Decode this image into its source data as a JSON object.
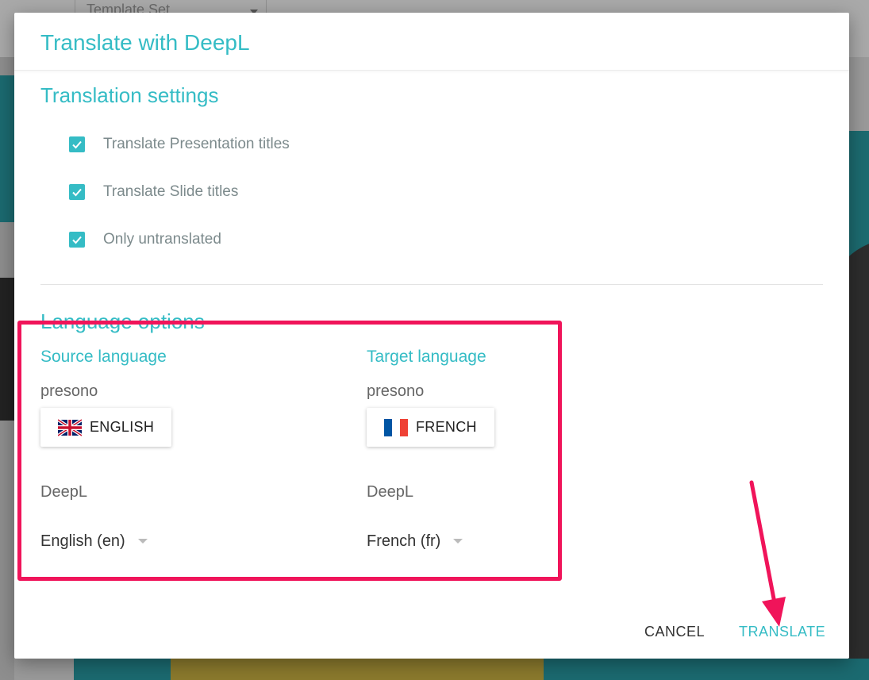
{
  "background": {
    "template_set_label": "Template Set"
  },
  "dialog": {
    "title": "Translate with DeepL",
    "settings": {
      "title": "Translation settings",
      "options": [
        {
          "label": "Translate Presentation titles",
          "checked": true
        },
        {
          "label": "Translate Slide titles",
          "checked": true
        },
        {
          "label": "Only untranslated",
          "checked": true
        }
      ]
    },
    "language_options": {
      "title": "Language options",
      "source": {
        "heading": "Source language",
        "provider": "presono",
        "button_label": "ENGLISH",
        "flag_icon": "uk-flag-icon",
        "deepl_label": "DeepL",
        "select_value": "English (en)"
      },
      "target": {
        "heading": "Target language",
        "provider": "presono",
        "button_label": "FRENCH",
        "flag_icon": "france-flag-icon",
        "deepl_label": "DeepL",
        "select_value": "French (fr)"
      }
    },
    "actions": {
      "cancel_label": "CANCEL",
      "translate_label": "TRANSLATE"
    }
  },
  "colors": {
    "accent": "#35bcc5",
    "annotation": "#f0145a"
  }
}
